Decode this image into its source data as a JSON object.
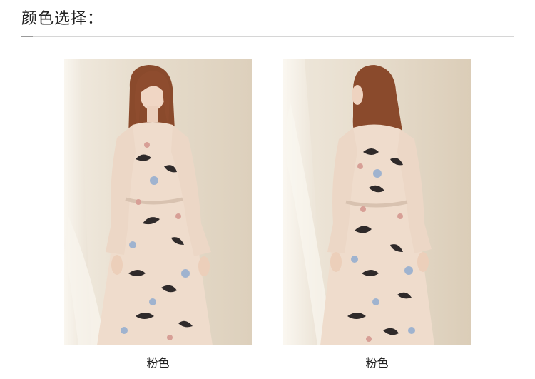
{
  "section": {
    "title": "颜色选择："
  },
  "swatches": [
    {
      "view": "front",
      "caption": "粉色"
    },
    {
      "view": "back",
      "caption": "粉色"
    }
  ],
  "colors": {
    "backdrop": "#e6dccd",
    "dress": "#efdccc",
    "hair": "#8a4a2c",
    "print_dark": "#2f2a2a",
    "print_blue": "#9fb3cf"
  }
}
